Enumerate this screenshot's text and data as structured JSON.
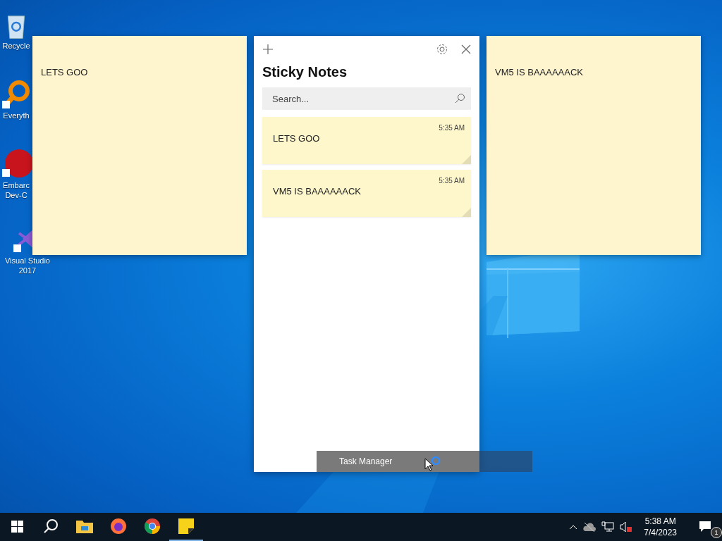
{
  "desktop_icons": [
    {
      "label": "Recycle",
      "kind": "recycle"
    },
    {
      "label": "Everyth",
      "kind": "search"
    },
    {
      "label": "Embarc\nDev-C",
      "kind": "dev"
    },
    {
      "label": "Visual Studio\n2017",
      "kind": "vs"
    }
  ],
  "left_note": {
    "text": "LETS GOO"
  },
  "right_note": {
    "text": "VM5 IS BAAAAAACK"
  },
  "sticky_notes": {
    "title": "Sticky Notes",
    "search": {
      "placeholder": "Search..."
    },
    "notes": [
      {
        "time": "5:35 AM",
        "text": "LETS GOO"
      },
      {
        "time": "5:35 AM",
        "text": "VM5 IS BAAAAAACK"
      }
    ]
  },
  "tooltip": {
    "text": "Task Manager"
  },
  "taskbar": {
    "apps": [
      {
        "kind": "explorer",
        "selected": false
      },
      {
        "kind": "firefox",
        "selected": false
      },
      {
        "kind": "chrome",
        "selected": false
      },
      {
        "kind": "sticky",
        "selected": true
      }
    ],
    "time": "5:38 AM",
    "date": "7/4/2023",
    "notification_count": "1"
  }
}
